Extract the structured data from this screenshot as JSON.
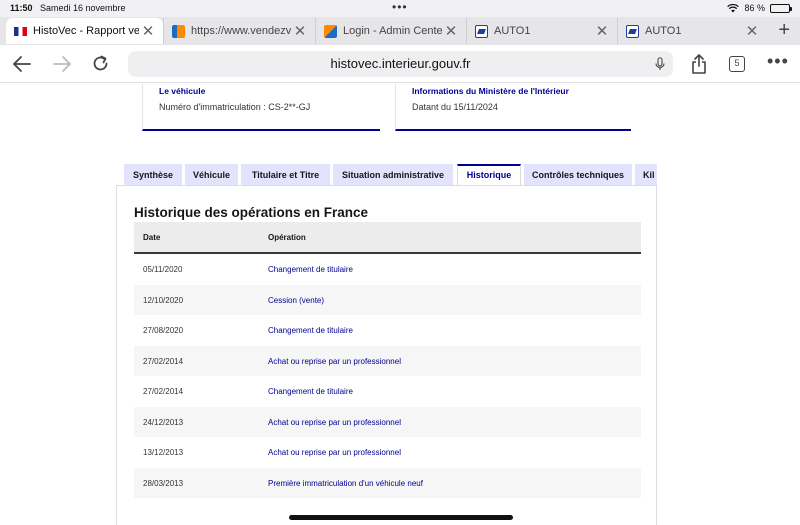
{
  "status_bar": {
    "time": "11:50",
    "date": "Samedi 16 novembre",
    "battery": "86 %",
    "battery_level": 0.86
  },
  "tabs": [
    {
      "title": "HistoVec - Rapport ve",
      "active": true
    },
    {
      "title": "https://www.vendezvo",
      "active": false
    },
    {
      "title": "Login - Admin Center",
      "active": false
    },
    {
      "title": "AUTO1",
      "active": false
    },
    {
      "title": "AUTO1",
      "active": false
    }
  ],
  "toolbar": {
    "url": "histovec.interieur.gouv.fr",
    "tab_count": "5"
  },
  "cards": {
    "vehicle": {
      "title": "Le véhicule",
      "text": "Numéro d'immatriculation : CS-2**-GJ"
    },
    "ministry": {
      "title": "Informations du Ministère de l'Intérieur",
      "text": "Datant du 15/11/2024"
    }
  },
  "nav_tabs": [
    {
      "label": "Synthèse",
      "active": false
    },
    {
      "label": "Véhicule",
      "active": false
    },
    {
      "label": "Titulaire et Titre",
      "active": false
    },
    {
      "label": "Situation administrative",
      "active": false
    },
    {
      "label": "Historique",
      "active": true
    },
    {
      "label": "Contrôles techniques",
      "active": false
    },
    {
      "label": "Kil",
      "active": false
    }
  ],
  "history": {
    "title": "Historique des opérations en France",
    "columns": {
      "date": "Date",
      "operation": "Opération"
    },
    "rows": [
      {
        "date": "05/11/2020",
        "operation": "Changement de titulaire"
      },
      {
        "date": "12/10/2020",
        "operation": "Cession (vente)"
      },
      {
        "date": "27/08/2020",
        "operation": "Changement de titulaire"
      },
      {
        "date": "27/02/2014",
        "operation": "Achat ou reprise par un professionnel"
      },
      {
        "date": "27/02/2014",
        "operation": "Changement de titulaire"
      },
      {
        "date": "24/12/2013",
        "operation": "Achat ou reprise par un professionnel"
      },
      {
        "date": "13/12/2013",
        "operation": "Achat ou reprise par un professionnel"
      },
      {
        "date": "28/03/2013",
        "operation": "Première immatriculation d'un véhicule neuf"
      }
    ]
  },
  "colors": {
    "accent": "#000091",
    "tab_bg": "#e3e3fd"
  }
}
